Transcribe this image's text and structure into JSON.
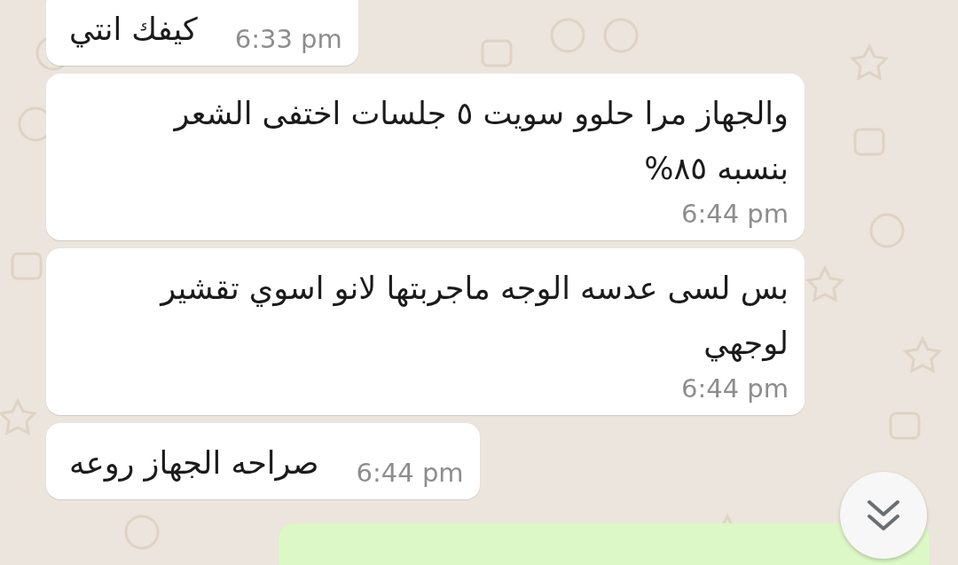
{
  "messages": [
    {
      "kind": "incoming",
      "text": "كيفك انتي",
      "time": "6:33 pm"
    },
    {
      "kind": "incoming",
      "text": "والجهاز مرا حلوو سويت ٥ جلسات اختفى الشعر بنسبه ٨٥%",
      "time": "6:44 pm"
    },
    {
      "kind": "incoming",
      "text": "بس لسى عدسه الوجه ماجربتها لانو اسوي تقشير لوجهي",
      "time": "6:44 pm"
    },
    {
      "kind": "incoming",
      "text": "صراحه الجهاز روعه",
      "time": "6:44 pm"
    },
    {
      "kind": "outgoing"
    }
  ],
  "scroll_down_button": {
    "visible": true
  }
}
